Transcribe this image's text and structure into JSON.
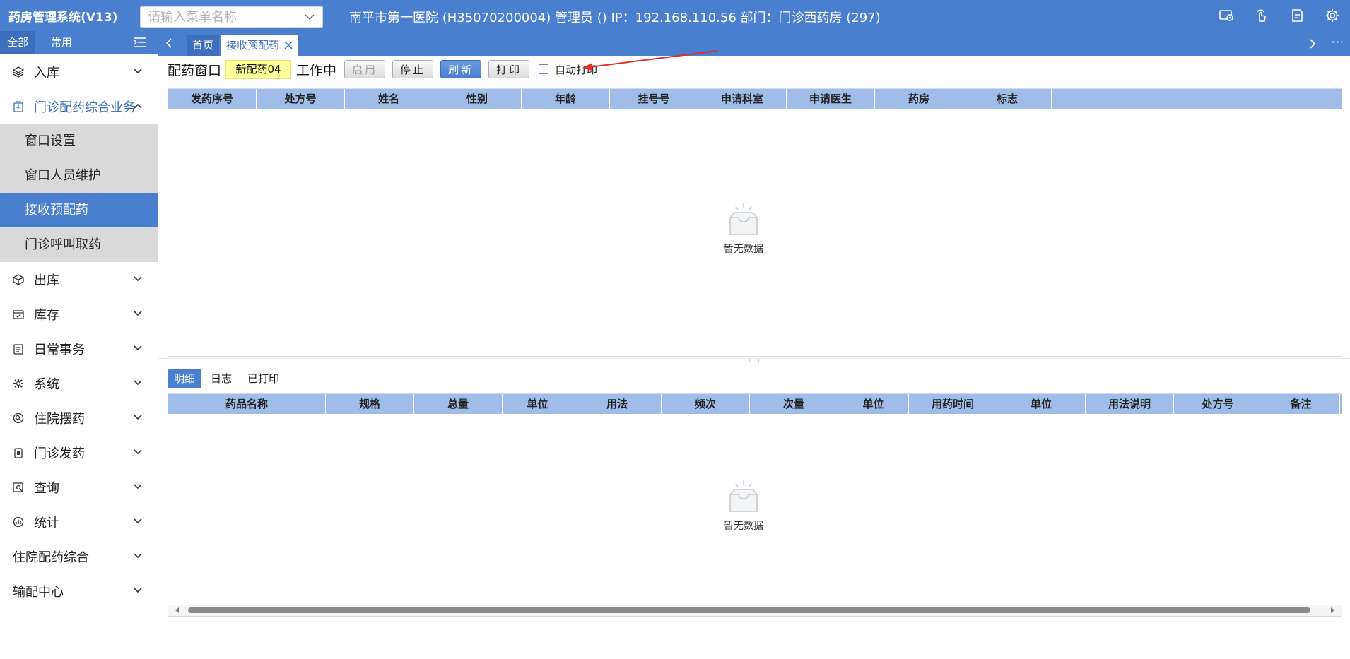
{
  "app": {
    "title": "药房管理系统(V13)",
    "menu_search_placeholder": "请输入菜单名称",
    "info": "南平市第一医院 (H35070200004) 管理员 () IP：192.168.110.56 部门：门诊西药房 (297)"
  },
  "topbar_icons": [
    "screen-settings-icon",
    "hand-pointer-icon",
    "document-export-icon",
    "gear-icon"
  ],
  "sidebar": {
    "tabs": [
      "全部",
      "常用"
    ],
    "items": [
      {
        "label": "入库",
        "icon": "inbound-icon"
      },
      {
        "label": "门诊配药综合业务",
        "icon": "pharmacy-icon",
        "open": true,
        "children": [
          "窗口设置",
          "窗口人员维护",
          "接收预配药",
          "门诊呼叫取药"
        ],
        "active_child": 2
      },
      {
        "label": "出库",
        "icon": "outbound-icon"
      },
      {
        "label": "库存",
        "icon": "inventory-icon"
      },
      {
        "label": "日常事务",
        "icon": "clipboard-icon"
      },
      {
        "label": "系统",
        "icon": "gear-icon"
      },
      {
        "label": "住院摆药",
        "icon": "search-circle-icon"
      },
      {
        "label": "门诊发药",
        "icon": "dispense-icon"
      },
      {
        "label": "查询",
        "icon": "query-icon"
      },
      {
        "label": "统计",
        "icon": "stats-icon"
      },
      {
        "label": "住院配药综合",
        "icon": ""
      },
      {
        "label": "输配中心",
        "icon": ""
      }
    ]
  },
  "tabs": {
    "home": "首页",
    "active": "接收预配药",
    "more": "···"
  },
  "toolbar": {
    "window_label": "配药窗口",
    "window_name": "新配药04",
    "status": "工作中",
    "btn_enable": "启用",
    "btn_stop": "停止",
    "btn_refresh": "刷新",
    "btn_print": "打印",
    "auto_print": "自动打印"
  },
  "top_grid": {
    "columns": [
      "发药序号",
      "处方号",
      "姓名",
      "性别",
      "年龄",
      "挂号号",
      "申请科室",
      "申请医生",
      "药房",
      "标志"
    ],
    "empty_text": "暂无数据"
  },
  "bottom_tabs": [
    "明细",
    "日志",
    "已打印"
  ],
  "bottom_grid": {
    "columns": [
      "药品名称",
      "规格",
      "总量",
      "单位",
      "用法",
      "频次",
      "次量",
      "单位",
      "用药时间",
      "单位",
      "用法说明",
      "处方号",
      "备注"
    ],
    "empty_text": "暂无数据"
  },
  "colors": {
    "primary": "#4a7fcf",
    "header": "#a0bde9",
    "highlight": "#ffff99",
    "annotation": "#e0302a"
  }
}
